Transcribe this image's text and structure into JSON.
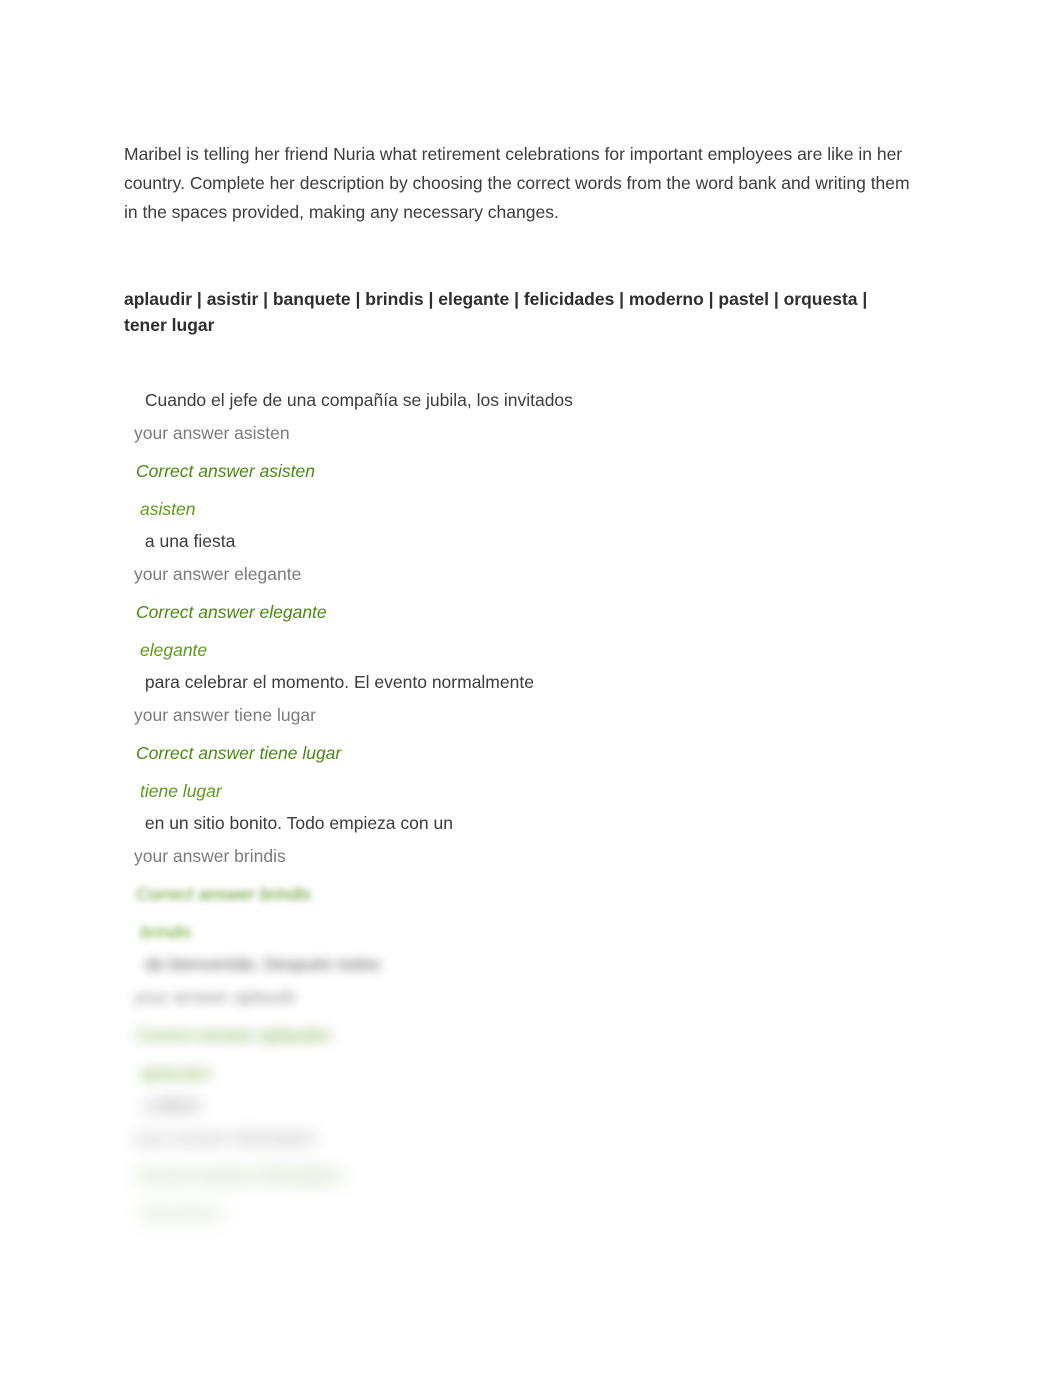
{
  "document": {
    "instructions": "Maribel is telling her friend Nuria what retirement celebrations for important employees are like in her country. Complete her description by choosing the correct words from the word bank and writing them in the spaces provided, making any necessary changes.",
    "word_bank": "aplaudir | asistir | banquete | brindis | elegante | felicidades | moderno | pastel | orquesta | tener lugar",
    "labels": {
      "your_answer_prefix": "your answer",
      "correct_answer_prefix": "Correct answer"
    },
    "colors": {
      "body_text": "#3c3c3c",
      "your_answer_gray": "#7b7b7b",
      "correct_answer_green": "#4a8a10",
      "given_answer_green": "#5a9c16",
      "page_background": "#ffffff"
    },
    "blocks": [
      {
        "fragment": " Cuando el jefe de una compañía se jubila, los invitados",
        "your_answer": "your answer asisten",
        "correct_answer": "Correct answer asisten",
        "given_answer": "asisten"
      },
      {
        "fragment": " a una fiesta",
        "your_answer": "your answer elegante",
        "correct_answer": "Correct answer elegante",
        "given_answer": "elegante"
      },
      {
        "fragment": " para celebrar el momento. El evento normalmente",
        "your_answer": "your answer tiene lugar",
        "correct_answer": "Correct answer tiene lugar",
        "given_answer": "tiene lugar"
      },
      {
        "fragment": " en un sitio bonito. Todo empieza con un",
        "your_answer": "your answer brindis",
        "correct_answer": "Correct answer brindis",
        "given_answer": "brindis"
      },
      {
        "fragment": " de bienvenida. Después todos",
        "your_answer": "your answer aplaudir",
        "correct_answer": "Correct answer aplauden",
        "given_answer": "aplauden"
      },
      {
        "fragment": " y dicen",
        "your_answer": "your answer felicidades",
        "correct_answer": "Correct answer felicidades",
        "given_answer": "felicidades"
      }
    ]
  }
}
